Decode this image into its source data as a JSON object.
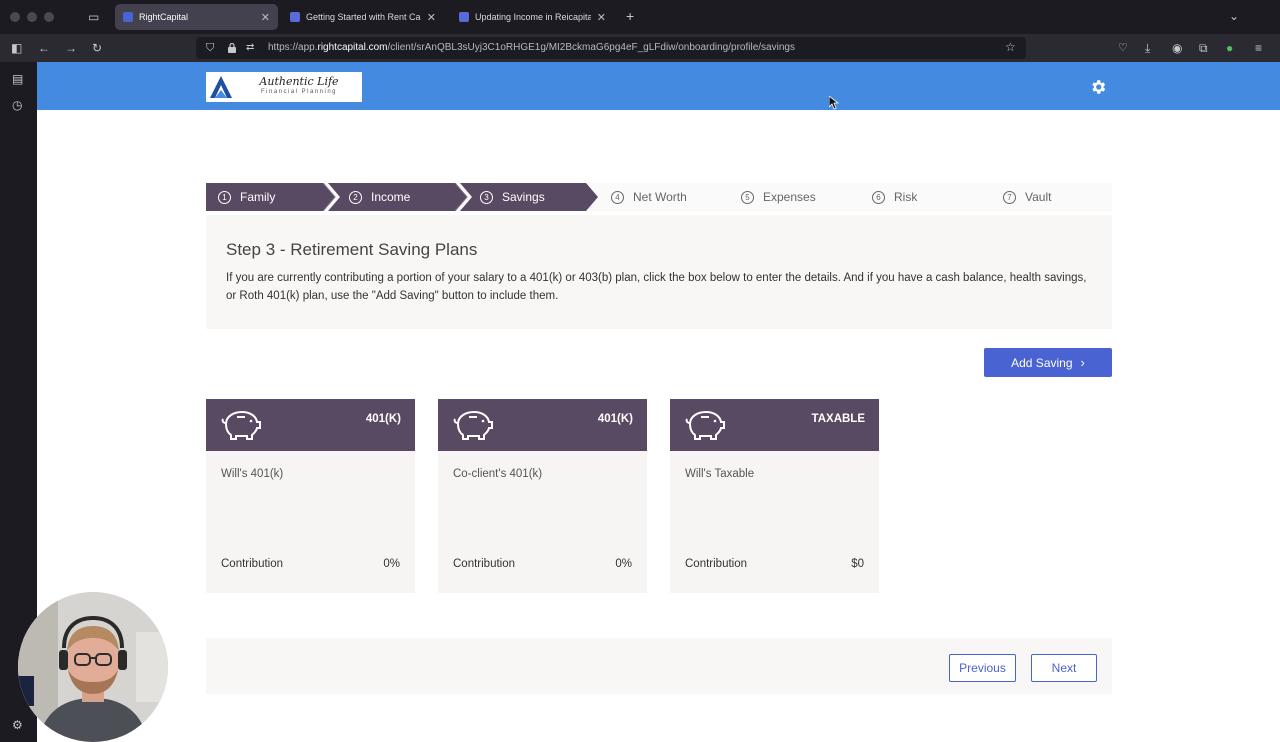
{
  "browser": {
    "tabs": [
      {
        "title": "RightCapital",
        "active": true,
        "favicon_color": "#4a63d3"
      },
      {
        "title": "Getting Started with Rent Capital",
        "active": false,
        "favicon_color": "#5a6ad8"
      },
      {
        "title": "Updating Income in Reicapital",
        "active": false,
        "favicon_color": "#5a6ad8"
      }
    ],
    "new_tab_symbol": "+",
    "url_prefix": "https://app.",
    "url_domain": "rightcapital.com",
    "url_path": "/client/srAnQBL3sUyj3C1oRHGE1g/MI2BckmaG6pg4eF_gLFdiw/onboarding/profile/savings"
  },
  "header": {
    "logo_name": "Authentic Life",
    "logo_tagline": "Financial Planning",
    "brand_color": "#438ae0"
  },
  "stepper": {
    "steps": [
      {
        "num": "1",
        "label": "Family",
        "state": "done"
      },
      {
        "num": "2",
        "label": "Income",
        "state": "done"
      },
      {
        "num": "3",
        "label": "Savings",
        "state": "current"
      },
      {
        "num": "4",
        "label": "Net Worth",
        "state": "todo"
      },
      {
        "num": "5",
        "label": "Expenses",
        "state": "todo"
      },
      {
        "num": "6",
        "label": "Risk",
        "state": "todo"
      },
      {
        "num": "7",
        "label": "Vault",
        "state": "todo"
      }
    ],
    "active_color": "#594a63"
  },
  "panel": {
    "title": "Step 3 - Retirement Saving Plans",
    "description": "If you are currently contributing a portion of your salary to a 401(k) or 403(b) plan, click the box below to enter the details. And if you have a cash balance, health savings, or Roth 401(k) plan, use the \"Add Saving\" button to include them."
  },
  "add_saving_label": "Add Saving",
  "cards": [
    {
      "type": "401(K)",
      "name": "Will's 401(k)",
      "contribution_label": "Contribution",
      "contribution_value": "0%"
    },
    {
      "type": "401(K)",
      "name": "Co-client's 401(k)",
      "contribution_label": "Contribution",
      "contribution_value": "0%"
    },
    {
      "type": "TAXABLE",
      "name": "Will's Taxable",
      "contribution_label": "Contribution",
      "contribution_value": "$0"
    }
  ],
  "footer": {
    "previous_label": "Previous",
    "next_label": "Next"
  }
}
